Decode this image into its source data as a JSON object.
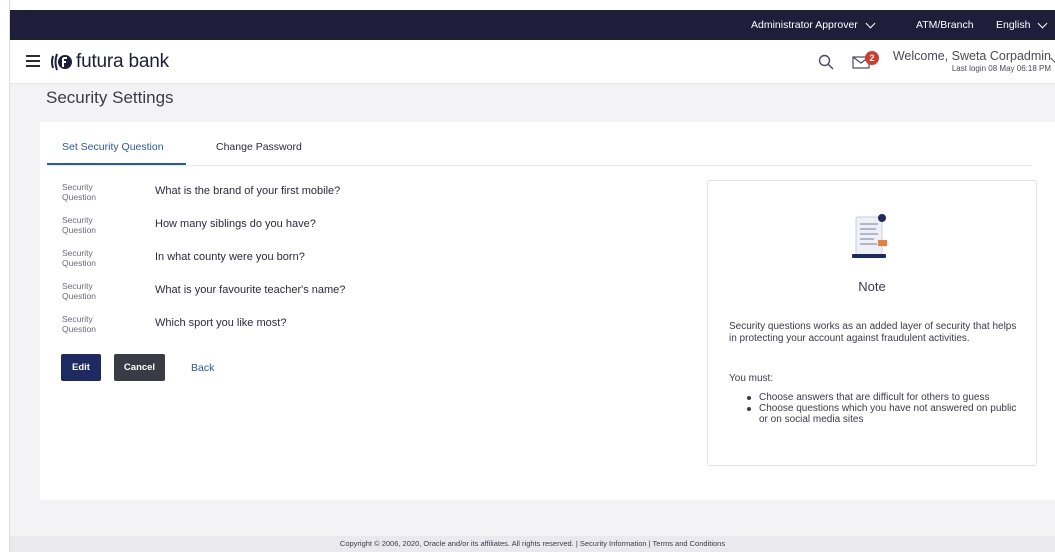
{
  "topbar": {
    "role": "Administrator Approver",
    "branch": "ATM/Branch",
    "language": "English"
  },
  "header": {
    "brand": "futura bank",
    "notification_count": "2",
    "welcome": "Welcome, Sweta Corpadmin",
    "last_login": "Last login 08 May 06:18 PM"
  },
  "page": {
    "title": "Security Settings"
  },
  "tabs": [
    {
      "label": "Set Security Question",
      "active": true
    },
    {
      "label": "Change Password",
      "active": false
    }
  ],
  "questions": [
    {
      "label": "Security Question",
      "value": "What is the brand of your first mobile?"
    },
    {
      "label": "Security Question",
      "value": "How many siblings do you have?"
    },
    {
      "label": "Security Question",
      "value": "In what county were you born?"
    },
    {
      "label": "Security Question",
      "value": "What is your favourite teacher's name?"
    },
    {
      "label": "Security Question",
      "value": "Which sport you like most?"
    }
  ],
  "actions": {
    "edit": "Edit",
    "cancel": "Cancel",
    "back": "Back"
  },
  "note": {
    "title": "Note",
    "text": "Security questions works as an added layer of security that helps in protecting your account against fraudulent activities.",
    "must": "You must:",
    "points": [
      "Choose answers that are difficult for others to guess",
      "Choose questions which you have not answered on public or on social media sites"
    ]
  },
  "footer": {
    "text": "Copyright © 2006, 2020, Oracle and/or its affiliates. All rights reserved. | Security Information | Terms and Conditions"
  },
  "colors": {
    "topbar": "#1e1e3a",
    "accent": "#2b5aa8",
    "primary_button": "#1e2b63",
    "secondary_button": "#3b3b48",
    "badge": "#d23c2c"
  }
}
